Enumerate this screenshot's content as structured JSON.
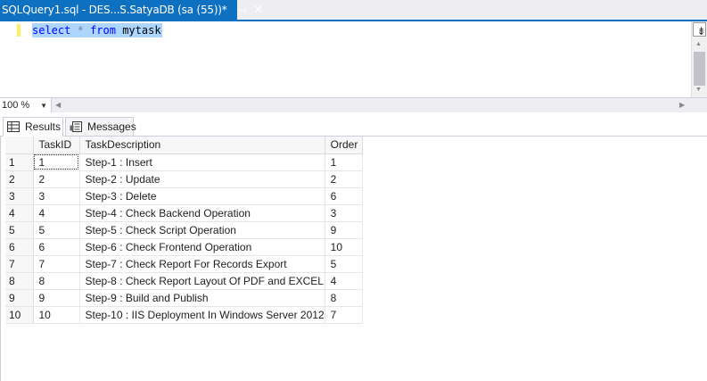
{
  "tab": {
    "title": "SQLQuery1.sql - DES...S.SatyaDB (sa (55))*",
    "pin": "⊣",
    "close": "✕"
  },
  "editor": {
    "kw_select": "select",
    "star": "*",
    "kw_from": "from",
    "table": "mytask"
  },
  "zoom": {
    "value": "100 %"
  },
  "results_tabs": {
    "results": "Results",
    "messages": "Messages"
  },
  "grid": {
    "columns": [
      "",
      "TaskID",
      "TaskDescription",
      "Order"
    ],
    "rows": [
      {
        "n": "1",
        "id": "1",
        "desc": "Step-1 : Insert",
        "order": "1"
      },
      {
        "n": "2",
        "id": "2",
        "desc": "Step-2 : Update",
        "order": "2"
      },
      {
        "n": "3",
        "id": "3",
        "desc": "Step-3 : Delete",
        "order": "6"
      },
      {
        "n": "4",
        "id": "4",
        "desc": "Step-4 : Check Backend Operation",
        "order": "3"
      },
      {
        "n": "5",
        "id": "5",
        "desc": "Step-5 : Check Script Operation",
        "order": "9"
      },
      {
        "n": "6",
        "id": "6",
        "desc": "Step-6 : Check Frontend Operation",
        "order": "10"
      },
      {
        "n": "7",
        "id": "7",
        "desc": "Step-7 : Check Report For Records Export",
        "order": "5"
      },
      {
        "n": "8",
        "id": "8",
        "desc": "Step-8 : Check Report Layout Of PDF and EXCEL",
        "order": "4"
      },
      {
        "n": "9",
        "id": "9",
        "desc": "Step-9 : Build and Publish",
        "order": "8"
      },
      {
        "n": "10",
        "id": "10",
        "desc": "Step-10 : IIS Deployment In Windows Server 2012",
        "order": "7"
      }
    ]
  },
  "colors": {
    "accent": "#0e70c0",
    "selection": "#add6ff",
    "keyword": "#0000ff"
  }
}
